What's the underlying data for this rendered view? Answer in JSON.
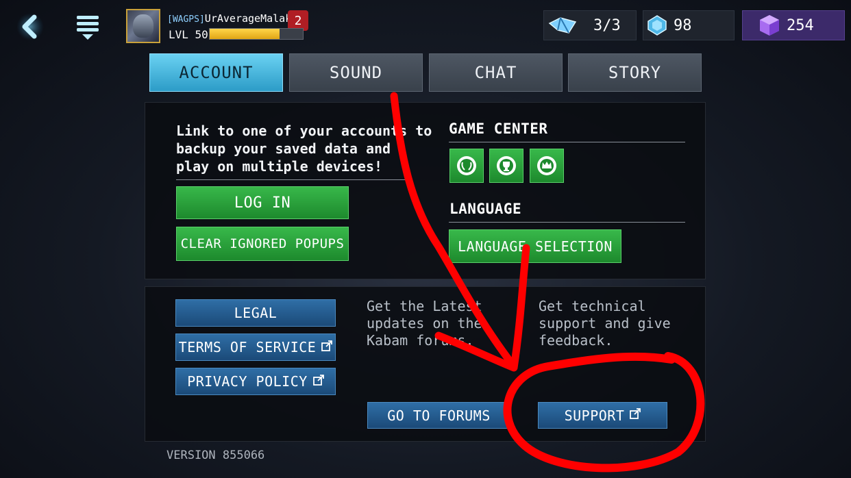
{
  "topbar": {
    "alliance_tag": "[WAGPS]",
    "player_name": "UrAverageMalaka",
    "notification_count": "2",
    "level_label": "LVL 50",
    "xp_progress_pct": 75,
    "energy": "3/3",
    "crystals": "98",
    "units": "254"
  },
  "tabs": [
    {
      "label": "ACCOUNT",
      "active": true
    },
    {
      "label": "SOUND",
      "active": false
    },
    {
      "label": "CHAT",
      "active": false
    },
    {
      "label": "STORY",
      "active": false
    }
  ],
  "account": {
    "description_lines": [
      "Link to one of your accounts to",
      "backup your saved data and",
      "play on multiple devices!"
    ],
    "login_label": "LOG IN",
    "clear_popups_label": "CLEAR IGNORED POPUPS",
    "game_center_heading": "GAME CENTER",
    "game_center_icons": [
      "laurel-icon",
      "trophy-icon",
      "crown-icon"
    ],
    "language_heading": "LANGUAGE",
    "language_button_label": "LANGUAGE SELECTION"
  },
  "links": {
    "legal_label": "LEGAL",
    "terms_label": "TERMS OF SERVICE",
    "privacy_label": "PRIVACY POLICY",
    "forums_blurb_lines": [
      "Get the Latest",
      "updates on the",
      "Kabam forums."
    ],
    "support_blurb_lines": [
      "Get technical",
      "support and give",
      "feedback."
    ],
    "forums_button_label": "GO TO FORUMS",
    "support_button_label": "SUPPORT"
  },
  "footer": {
    "version": "VERSION 855066"
  },
  "colors": {
    "tab_active": "#2c9cc7",
    "green_button": "#1d8a2d",
    "blue_button": "#1b4a78",
    "annotation_red": "#ff0000"
  }
}
